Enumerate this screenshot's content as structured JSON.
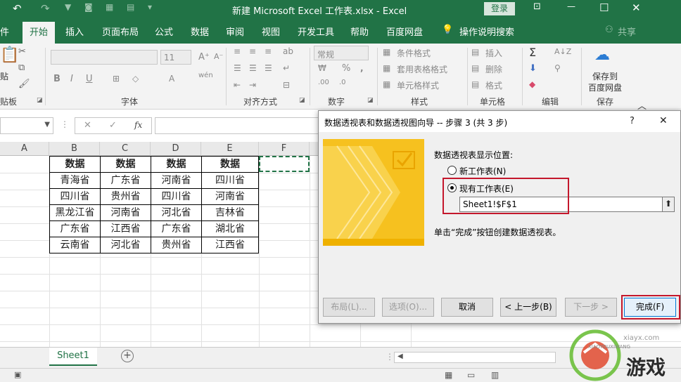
{
  "titlebar": {
    "title": "新建 Microsoft Excel 工作表.xlsx  -  Excel",
    "login": "登录",
    "undo_icon": "↶",
    "redo_icon": "↷",
    "minimize": "—",
    "maximize": "☐",
    "close": "✕",
    "ribbon_display": "⊡"
  },
  "tabs": [
    "件",
    "开始",
    "插入",
    "页面布局",
    "公式",
    "数据",
    "审阅",
    "视图",
    "开发工具",
    "帮助",
    "百度网盘",
    "操作说明搜索",
    "共享"
  ],
  "ribbon": {
    "clipboard_label": "贴板",
    "paste_label": "贴",
    "font_label": "字体",
    "font_size": "11",
    "font_buttons": [
      "B",
      "I",
      "U"
    ],
    "align_label": "对齐方式",
    "number_label": "数字",
    "number_format": "常规",
    "styles_label": "样式",
    "styles_items": [
      "条件格式",
      "套用表格格式",
      "单元格样式"
    ],
    "cells_label": "单元格",
    "cells_items": [
      "插入",
      "删除",
      "格式"
    ],
    "edit_label": "编辑",
    "save_label": "保存",
    "save_to_baidu": [
      "保存到",
      "百度网盘"
    ]
  },
  "formula_bar": {
    "fx": "fx"
  },
  "columns": [
    "A",
    "B",
    "C",
    "D",
    "E",
    "F"
  ],
  "table": {
    "headers": [
      "数据",
      "数据",
      "数据",
      "数据"
    ],
    "rows": [
      [
        "青海省",
        "广东省",
        "河南省",
        "四川省"
      ],
      [
        "四川省",
        "贵州省",
        "四川省",
        "河南省"
      ],
      [
        "黑龙江省",
        "河南省",
        "河北省",
        "吉林省"
      ],
      [
        "广东省",
        "江西省",
        "广东省",
        "湖北省"
      ],
      [
        "云南省",
        "河北省",
        "贵州省",
        "江西省"
      ]
    ]
  },
  "sheet": {
    "tab": "Sheet1",
    "add": "+"
  },
  "dialog": {
    "title": "数据透视表和数据透视图向导 -- 步骤 3 (共 3 步)",
    "help": "?",
    "close": "✕",
    "prompt": "数据透视表显示位置:",
    "option_new": "新工作表(N)",
    "option_existing": "现有工作表(E)",
    "location_value": "Sheet1!$F$1",
    "hint": "单击“完成”按钮创建数据透视表。",
    "buttons": {
      "layout": "布局(L)...",
      "options": "选项(O)...",
      "cancel": "取消",
      "back": "< 上一步(B)",
      "next": "下一步 >",
      "finish": "完成(F)"
    }
  },
  "watermark": {
    "brand": "游戏",
    "site": "xiayx.com",
    "sub": "XIAOYOUXIWANG"
  }
}
